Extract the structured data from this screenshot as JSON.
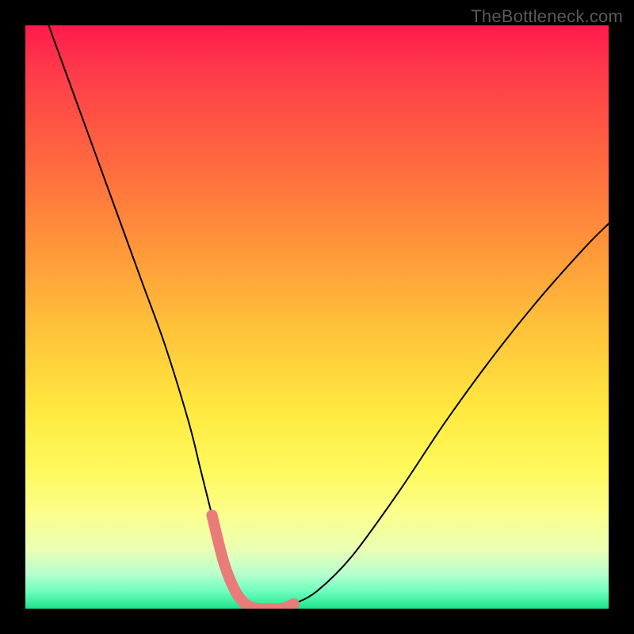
{
  "watermark": "TheBottleneck.com",
  "chart_data": {
    "type": "line",
    "title": "",
    "xlabel": "",
    "ylabel": "",
    "xlim": [
      0,
      100
    ],
    "ylim": [
      0,
      100
    ],
    "background_gradient_stops": [
      {
        "pct": 0,
        "color": "#ff1a4d"
      },
      {
        "pct": 8,
        "color": "#ff3b4a"
      },
      {
        "pct": 24,
        "color": "#ff6a3f"
      },
      {
        "pct": 38,
        "color": "#ff963a"
      },
      {
        "pct": 52,
        "color": "#ffc23a"
      },
      {
        "pct": 66,
        "color": "#ffe93f"
      },
      {
        "pct": 76,
        "color": "#fff95c"
      },
      {
        "pct": 84,
        "color": "#fbff8e"
      },
      {
        "pct": 90,
        "color": "#e8ffb4"
      },
      {
        "pct": 94,
        "color": "#b8ffce"
      },
      {
        "pct": 97,
        "color": "#6effbf"
      },
      {
        "pct": 100,
        "color": "#1fe38a"
      }
    ],
    "series": [
      {
        "name": "bottleneck-curve",
        "stroke": "#000000",
        "stroke_width": 2,
        "x": [
          4,
          8,
          12,
          16,
          20,
          24,
          28,
          30,
          32,
          34,
          36,
          38,
          40,
          42,
          44,
          46,
          50,
          56,
          64,
          72,
          80,
          88,
          96,
          100
        ],
        "y": [
          100,
          89,
          78,
          67,
          56,
          45,
          32,
          24,
          16,
          8,
          3,
          0.6,
          0,
          0,
          0,
          0.8,
          3,
          9,
          20,
          32,
          43,
          53,
          62,
          66
        ]
      }
    ],
    "overlay_segment": {
      "name": "highlight-pink",
      "stroke": "#e97b78",
      "stroke_width": 14,
      "dot_radius": 7,
      "x": [
        32,
        34,
        36,
        38,
        40,
        42,
        44,
        46
      ],
      "y": [
        16,
        8,
        3,
        0.6,
        0,
        0,
        0,
        0.8
      ]
    }
  }
}
